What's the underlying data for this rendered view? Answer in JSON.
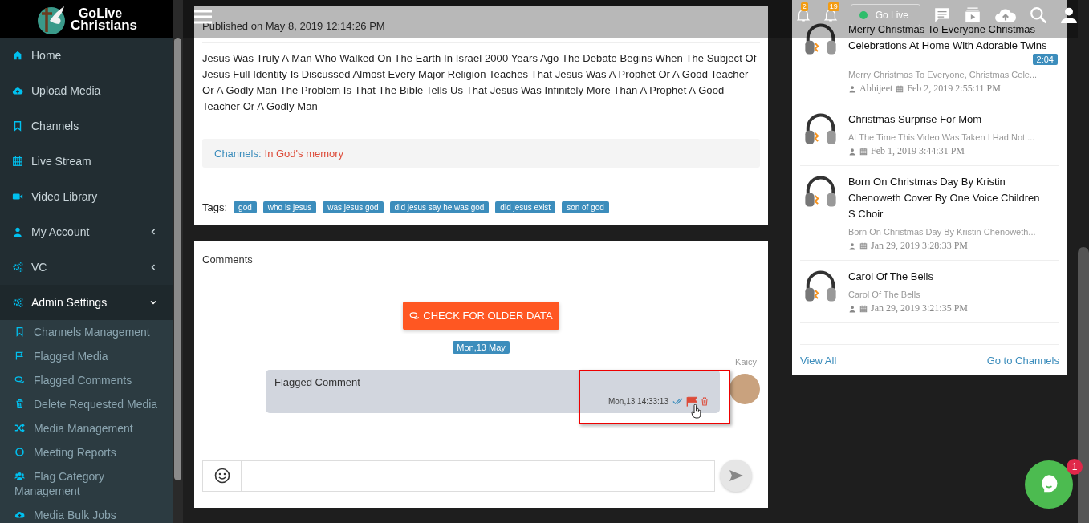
{
  "logo": {
    "line1": "GoLive",
    "line2": "Christians"
  },
  "sidebar": {
    "items": [
      {
        "label": "Home",
        "kind": "link"
      },
      {
        "label": "Upload Media",
        "kind": "link"
      },
      {
        "label": "Channels",
        "kind": "link"
      },
      {
        "label": "Live Stream",
        "kind": "link"
      },
      {
        "label": "Video Library",
        "kind": "link"
      },
      {
        "label": "My Account",
        "kind": "menu",
        "expanded": false
      },
      {
        "label": "VC",
        "kind": "menu",
        "expanded": false
      },
      {
        "label": "Admin Settings",
        "kind": "menu",
        "expanded": true,
        "children": [
          {
            "label": "Channels Management"
          },
          {
            "label": "Flagged Media"
          },
          {
            "label": "Flagged Comments"
          },
          {
            "label": "Delete Requested Media"
          },
          {
            "label": "Media Management"
          },
          {
            "label": "Meeting Reports"
          },
          {
            "label": "Flag Category Management"
          },
          {
            "label": "Media Bulk Jobs"
          }
        ]
      }
    ]
  },
  "header": {
    "notifications": [
      {
        "count": "2"
      },
      {
        "count": "19"
      }
    ],
    "go_live": {
      "label": "Go Live"
    }
  },
  "post": {
    "published": "Published on May 8, 2019 12:14:26 PM",
    "description": "Jesus Was Truly A Man Who Walked On The Earth In Israel 2000 Years Ago The Debate Begins When The Subject Of Jesus Full Identity Is Discussed Almost Every Major Religion Teaches That Jesus Was A Prophet Or A Good Teacher Or A Godly Man The Problem Is That The Bible Tells Us That Jesus Was Infinitely More Than A Prophet A Good Teacher Or A Godly Man",
    "channels": {
      "label": "Channels:",
      "value": "In God's memory"
    },
    "tags_label": "Tags:",
    "tags": [
      "god",
      "who is jesus",
      "was jesus god",
      "did jesus say he was god",
      "did jesus exist",
      "son of god"
    ]
  },
  "comments": {
    "title": "Comments",
    "older_button": "CHECK FOR OLDER DATA",
    "date_badge": "Mon,13 May",
    "messages": [
      {
        "author": "Kaicy",
        "text": "Flagged Comment",
        "time": "Mon,13 14:33:13",
        "read": true,
        "flagged": true,
        "highlighted": true
      }
    ]
  },
  "videos": {
    "items": [
      {
        "title": "Merry Christmas To Everyone Christmas Celebrations At Home With Adorable Twins",
        "duration": "2:04",
        "description": "Merry Christmas To Everyone, Christmas Cele...",
        "author": "Abhijeet",
        "date": "Feb 2, 2019 2:55:11 PM"
      },
      {
        "title": "Christmas Surprise For Mom",
        "description": "At The Time This Video Was Taken I Had Not ...",
        "date": "Feb 1, 2019 3:44:31 PM"
      },
      {
        "title": "Born On Christmas Day By Kristin Chenoweth Cover By One Voice Children S Choir",
        "description": "Born On Christmas Day By Kristin Chenoweth...",
        "date": "Jan 29, 2019 3:28:33 PM"
      },
      {
        "title": "Carol Of The Bells",
        "description": "Carol Of The Bells",
        "date": "Jan 29, 2019 3:21:35 PM"
      }
    ],
    "view_all": "View All",
    "go_channels": "Go to Channels"
  },
  "chat_widget": {
    "badge": "1"
  }
}
